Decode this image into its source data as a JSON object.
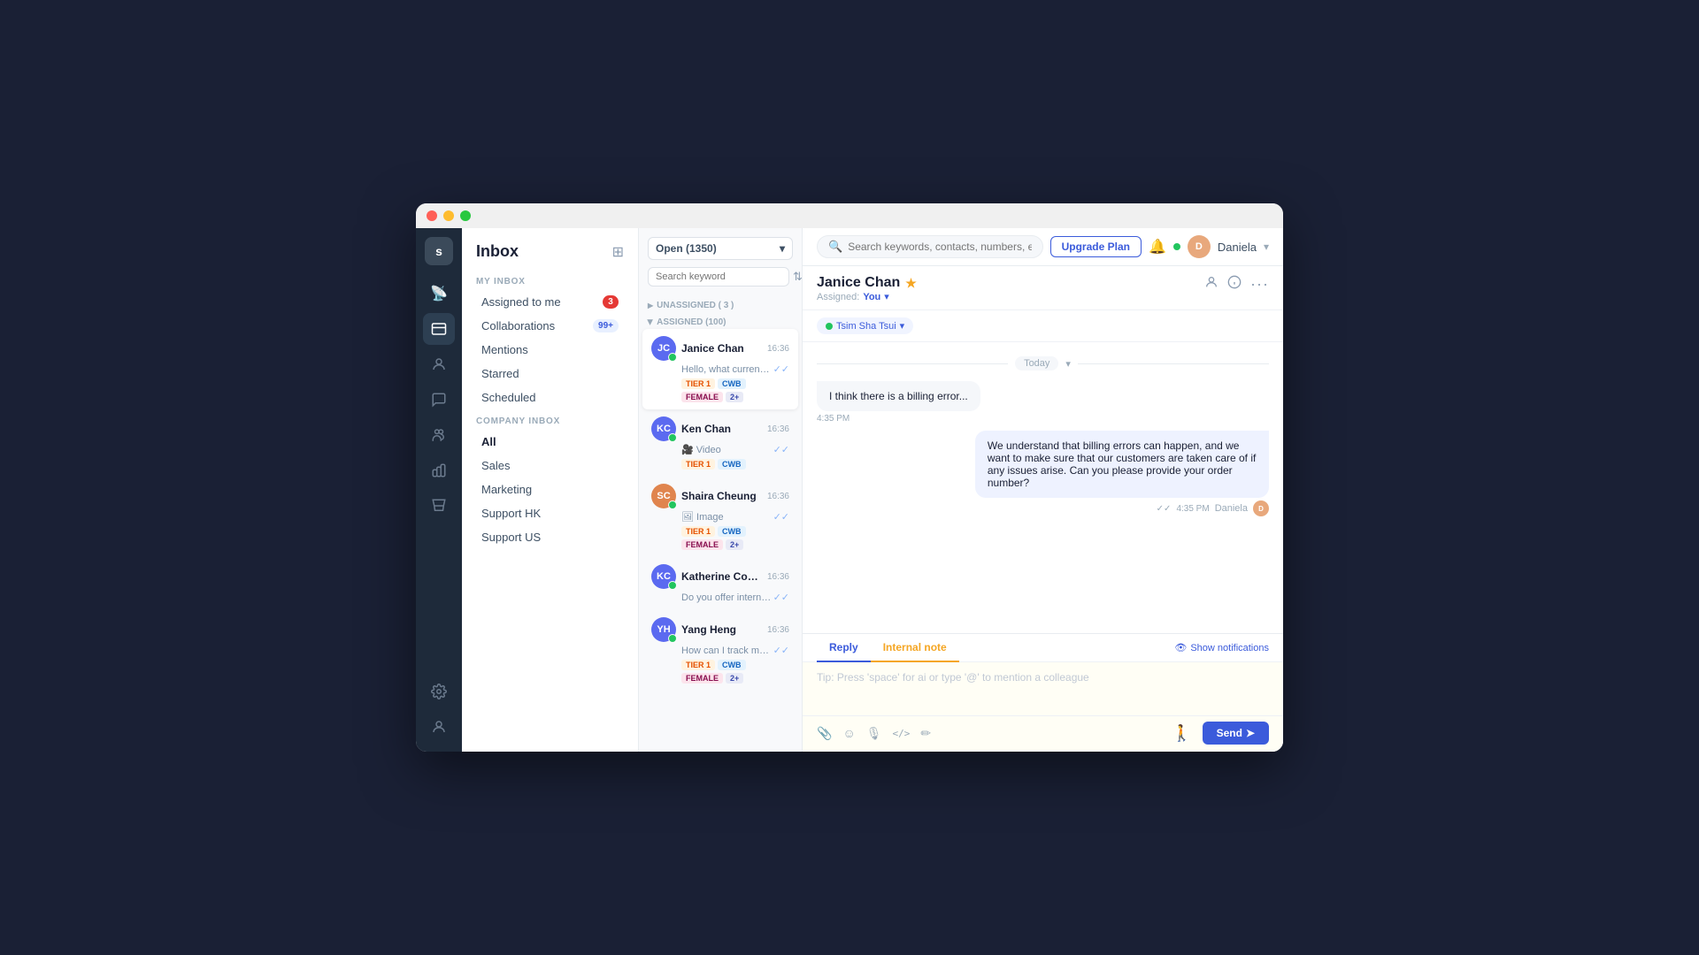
{
  "window": {
    "title": "Inbox"
  },
  "topbar": {
    "search_placeholder": "Search keywords, contacts, numbers, etc...",
    "upgrade_btn": "Upgrade Plan",
    "user_name": "Daniela",
    "user_initials": "D"
  },
  "sidebar": {
    "title": "Inbox",
    "my_inbox_label": "MY INBOX",
    "company_inbox_label": "COMPANY INBOX",
    "items_my": [
      {
        "label": "Assigned to me",
        "badge": "3",
        "badge_type": "red"
      },
      {
        "label": "Collaborations",
        "badge": "99+",
        "badge_type": "blue"
      },
      {
        "label": "Mentions",
        "badge": "",
        "badge_type": ""
      },
      {
        "label": "Starred",
        "badge": "",
        "badge_type": ""
      },
      {
        "label": "Scheduled",
        "badge": "",
        "badge_type": ""
      }
    ],
    "items_company": [
      {
        "label": "All",
        "active": true
      },
      {
        "label": "Sales"
      },
      {
        "label": "Marketing"
      },
      {
        "label": "Support HK"
      },
      {
        "label": "Support US"
      }
    ]
  },
  "conv_list": {
    "status": "Open (1350)",
    "search_placeholder": "Search keyword",
    "group_unassigned": "UNASSIGNED ( 3 )",
    "group_assigned": "ASSIGNED (100)",
    "conversations": [
      {
        "name": "Janice Chan",
        "time": "16:36",
        "preview": "Hello, what currency will orders be settled in?",
        "avatar_bg": "#5b6af0",
        "initials": "JC",
        "tags": [
          "TIER 1",
          "CWB",
          "FEMALE",
          "2+"
        ],
        "check": true,
        "active": true
      },
      {
        "name": "Ken Chan",
        "time": "16:36",
        "preview": "Video",
        "avatar_bg": "#5b6af0",
        "initials": "KC",
        "tags": [
          "TIER 1",
          "CWB"
        ],
        "check": true,
        "active": false
      },
      {
        "name": "Shaira Cheung",
        "time": "16:36",
        "preview": "Image",
        "avatar_bg": "#e0854e",
        "initials": "SC",
        "tags": [
          "TIER 1",
          "CWB",
          "FEMALE",
          "2+"
        ],
        "check": true,
        "active": false
      },
      {
        "name": "Katherine Concepcion",
        "time": "16:36",
        "preview": "Do you offer international shipping?",
        "avatar_bg": "#5b6af0",
        "initials": "KC",
        "tags": [],
        "check": true,
        "active": false
      },
      {
        "name": "Yang Heng",
        "time": "16:36",
        "preview": "How can I track my order once it has been shipped?",
        "avatar_bg": "#5b6af0",
        "initials": "YH",
        "tags": [
          "TIER 1",
          "CWB",
          "FEMALE",
          "2+"
        ],
        "check": true,
        "active": false
      }
    ]
  },
  "chat": {
    "contact_name": "Janice Chan",
    "assigned_label": "Assigned:",
    "assigned_val": "You",
    "channel": "Tsim Sha Tsui",
    "date_label": "Today",
    "messages": [
      {
        "type": "incoming",
        "text": "I think there is a billing error...",
        "time": "4:35 PM"
      },
      {
        "type": "outgoing",
        "text": "We understand that billing errors can happen, and we want to make sure that our customers are taken care of if any issues arise. Can you please provide your order number?",
        "time": "4:35 PM",
        "sender": "Daniela",
        "sender_initials": "D"
      }
    ],
    "compose": {
      "tab_reply": "Reply",
      "tab_internal_note": "Internal note",
      "placeholder": "Tip: Press 'space' for ai or type '@' to mention a colleague",
      "show_notifications": "Show notifications",
      "send_btn": "Send"
    }
  },
  "icons": {
    "logo": "s",
    "broadcast": "📡",
    "inbox": "📥",
    "contacts": "👤",
    "conversations": "💬",
    "team": "👥",
    "reports": "📊",
    "store": "🛒",
    "settings": "⚙",
    "profile": "👤",
    "bell": "🔔",
    "star": "★",
    "add_convo": "⊞",
    "search": "🔍",
    "sort": "⇅",
    "filter": "⚡",
    "arrow_down": "▾",
    "more": "···",
    "attachment": "📎",
    "emoji": "☺",
    "mic": "🎙",
    "code": "</>",
    "pen": "✏",
    "eye": "👁",
    "send_arrow": "➤"
  }
}
